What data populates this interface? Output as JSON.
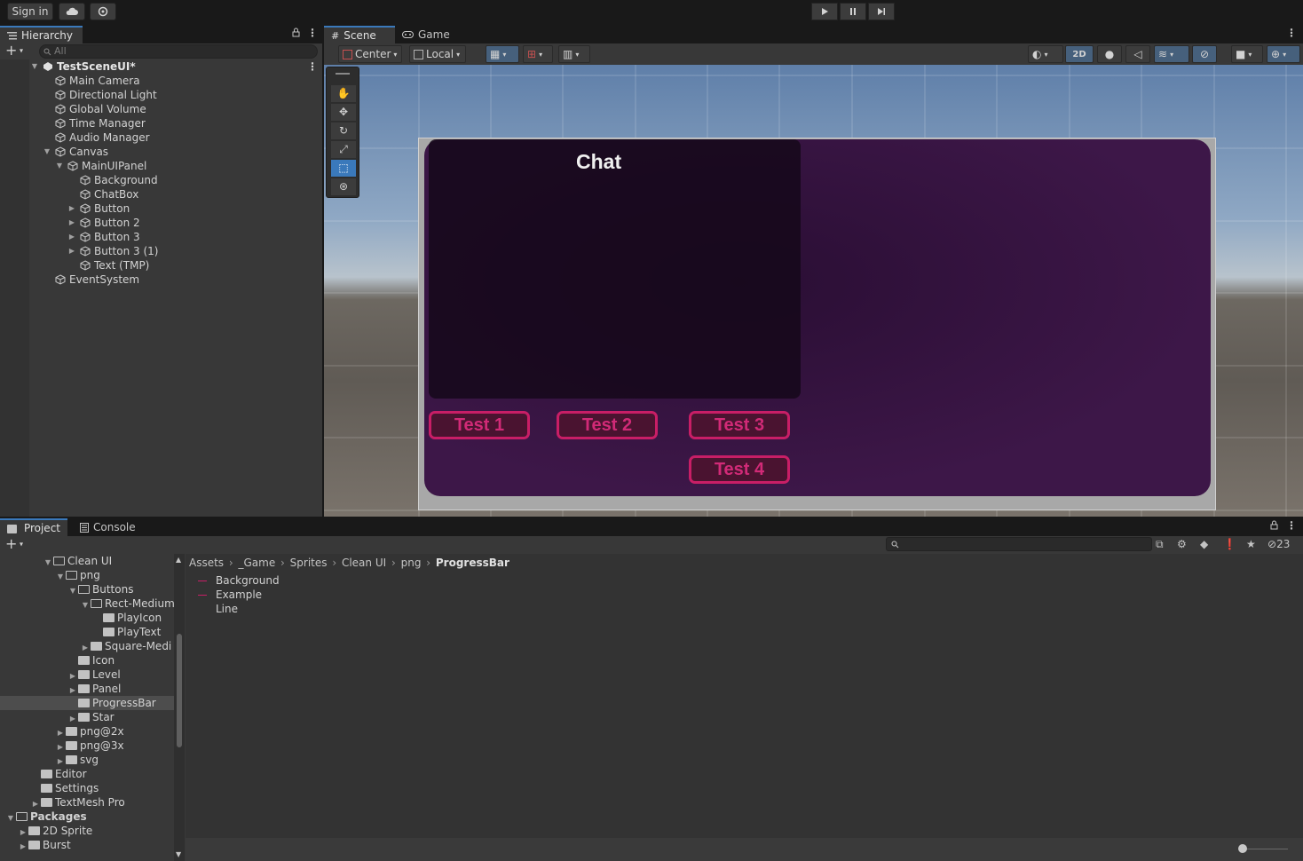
{
  "topbar": {
    "sign_in": "Sign in"
  },
  "hierarchy": {
    "tab_label": "Hierarchy",
    "search_placeholder": "All",
    "rows": [
      {
        "label": "TestSceneUI*",
        "depth": 0,
        "expand": "open",
        "kind": "scene"
      },
      {
        "label": "Main Camera",
        "depth": 1,
        "expand": "none"
      },
      {
        "label": "Directional Light",
        "depth": 1,
        "expand": "none"
      },
      {
        "label": "Global Volume",
        "depth": 1,
        "expand": "none"
      },
      {
        "label": "Time Manager",
        "depth": 1,
        "expand": "none"
      },
      {
        "label": "Audio Manager",
        "depth": 1,
        "expand": "none"
      },
      {
        "label": "Canvas",
        "depth": 1,
        "expand": "open"
      },
      {
        "label": "MainUIPanel",
        "depth": 2,
        "expand": "open"
      },
      {
        "label": "Background",
        "depth": 3,
        "expand": "none"
      },
      {
        "label": "ChatBox",
        "depth": 3,
        "expand": "none"
      },
      {
        "label": "Button",
        "depth": 3,
        "expand": "closed"
      },
      {
        "label": "Button 2",
        "depth": 3,
        "expand": "closed"
      },
      {
        "label": "Button 3",
        "depth": 3,
        "expand": "closed"
      },
      {
        "label": "Button 3 (1)",
        "depth": 3,
        "expand": "closed"
      },
      {
        "label": "Text (TMP)",
        "depth": 3,
        "expand": "none"
      },
      {
        "label": "EventSystem",
        "depth": 1,
        "expand": "none"
      }
    ]
  },
  "scene": {
    "tab_scene": "Scene",
    "tab_game": "Game",
    "pivot": "Center",
    "space": "Local",
    "mode_2d": "2D",
    "chat_title": "Chat",
    "buttons": [
      "Test 1",
      "Test 2",
      "Test 3",
      "Test 4"
    ]
  },
  "project": {
    "tab_project": "Project",
    "tab_console": "Console",
    "hidden_count": "23",
    "breadcrumb": [
      "Assets",
      "_Game",
      "Sprites",
      "Clean UI",
      "png",
      "ProgressBar"
    ],
    "tree": [
      {
        "label": "Clean UI",
        "depth": 3,
        "expand": "open",
        "open": true
      },
      {
        "label": "png",
        "depth": 4,
        "expand": "open",
        "open": true
      },
      {
        "label": "Buttons",
        "depth": 5,
        "expand": "open",
        "open": true
      },
      {
        "label": "Rect-Medium",
        "depth": 6,
        "expand": "open",
        "open": true
      },
      {
        "label": "PlayIcon",
        "depth": 7,
        "expand": "none"
      },
      {
        "label": "PlayText",
        "depth": 7,
        "expand": "none"
      },
      {
        "label": "Square-Medi",
        "depth": 6,
        "expand": "closed"
      },
      {
        "label": "Icon",
        "depth": 5,
        "expand": "none"
      },
      {
        "label": "Level",
        "depth": 5,
        "expand": "closed"
      },
      {
        "label": "Panel",
        "depth": 5,
        "expand": "closed"
      },
      {
        "label": "ProgressBar",
        "depth": 5,
        "expand": "none",
        "selected": true
      },
      {
        "label": "Star",
        "depth": 5,
        "expand": "closed"
      },
      {
        "label": "png@2x",
        "depth": 4,
        "expand": "closed"
      },
      {
        "label": "png@3x",
        "depth": 4,
        "expand": "closed"
      },
      {
        "label": "svg",
        "depth": 4,
        "expand": "closed"
      },
      {
        "label": "Editor",
        "depth": 2,
        "expand": "none"
      },
      {
        "label": "Settings",
        "depth": 2,
        "expand": "none"
      },
      {
        "label": "TextMesh Pro",
        "depth": 2,
        "expand": "closed"
      },
      {
        "label": "Packages",
        "depth": 0,
        "expand": "open",
        "open": true,
        "bold": true
      },
      {
        "label": "2D Sprite",
        "depth": 1,
        "expand": "closed"
      },
      {
        "label": "Burst",
        "depth": 1,
        "expand": "closed"
      }
    ],
    "files": [
      "Background",
      "Example",
      "Line"
    ]
  },
  "colors": {
    "accent": "#3a79bb",
    "button_pink": "#c81e66",
    "panel_purple": "#3b1546"
  }
}
